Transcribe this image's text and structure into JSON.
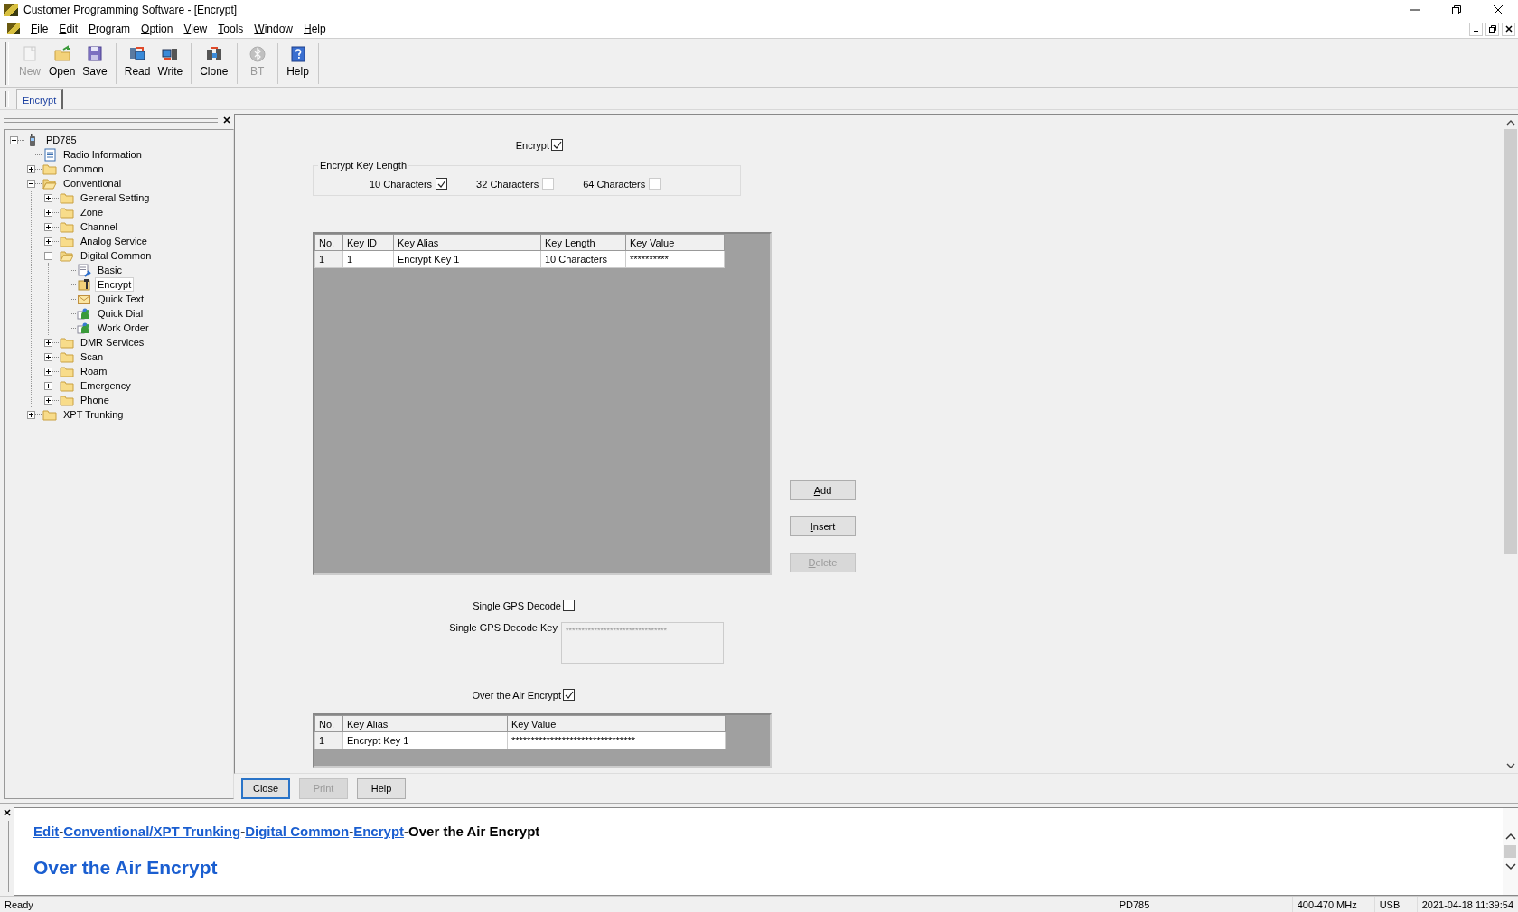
{
  "window": {
    "title": "Customer Programming Software - [Encrypt]"
  },
  "menu": [
    "File",
    "Edit",
    "Program",
    "Option",
    "View",
    "Tools",
    "Window",
    "Help"
  ],
  "toolbar": {
    "groups": [
      [
        {
          "label": "New",
          "kind": "new",
          "disabled": true
        },
        {
          "label": "Open",
          "kind": "open",
          "disabled": false
        },
        {
          "label": "Save",
          "kind": "save",
          "disabled": false
        }
      ],
      [
        {
          "label": "Read",
          "kind": "read",
          "disabled": false
        },
        {
          "label": "Write",
          "kind": "write",
          "disabled": false
        }
      ],
      [
        {
          "label": "Clone",
          "kind": "clone",
          "disabled": false
        }
      ],
      [
        {
          "label": "BT",
          "kind": "bluetooth",
          "disabled": true
        }
      ],
      [
        {
          "label": "Help",
          "kind": "help",
          "disabled": false
        }
      ]
    ]
  },
  "tabs": [
    {
      "label": "Encrypt",
      "selected": true
    }
  ],
  "tree": [
    {
      "label": "PD785",
      "kind": "radio",
      "expanded": true,
      "selected": false,
      "children": [
        {
          "label": "Radio Information",
          "kind": "info",
          "selected": false
        },
        {
          "label": "Common",
          "kind": "folder",
          "expanded": false,
          "selected": false
        },
        {
          "label": "Conventional",
          "kind": "folder",
          "expanded": true,
          "selected": false,
          "children": [
            {
              "label": "General Setting",
              "kind": "folder",
              "expanded": false,
              "selected": false
            },
            {
              "label": "Zone",
              "kind": "folder",
              "expanded": false,
              "selected": false
            },
            {
              "label": "Channel",
              "kind": "folder",
              "expanded": false,
              "selected": false
            },
            {
              "label": "Analog Service",
              "kind": "folder",
              "expanded": false,
              "selected": false
            },
            {
              "label": "Digital Common",
              "kind": "folder",
              "expanded": true,
              "selected": false,
              "children": [
                {
                  "label": "Basic",
                  "kind": "settings",
                  "selected": false
                },
                {
                  "label": "Encrypt",
                  "kind": "key",
                  "selected": true
                },
                {
                  "label": "Quick Text",
                  "kind": "mail",
                  "selected": false
                },
                {
                  "label": "Quick Dial",
                  "kind": "contacts",
                  "selected": false
                },
                {
                  "label": "Work Order",
                  "kind": "contacts",
                  "selected": false
                }
              ]
            },
            {
              "label": "DMR Services",
              "kind": "folder",
              "expanded": false,
              "selected": false
            },
            {
              "label": "Scan",
              "kind": "folder",
              "expanded": false,
              "selected": false
            },
            {
              "label": "Roam",
              "kind": "folder",
              "expanded": false,
              "selected": false
            },
            {
              "label": "Emergency",
              "kind": "folder",
              "expanded": false,
              "selected": false
            },
            {
              "label": "Phone",
              "kind": "folder",
              "expanded": false,
              "selected": false
            }
          ]
        },
        {
          "label": "XPT Trunking",
          "kind": "folder",
          "expanded": false,
          "selected": false
        }
      ]
    }
  ],
  "form": {
    "encrypt": {
      "label": "Encrypt",
      "checked": true
    },
    "key_length": {
      "title": "Encrypt Key Length",
      "options": [
        {
          "label": "10 Characters",
          "checked": true
        },
        {
          "label": "32 Characters",
          "checked": false
        },
        {
          "label": "64 Characters",
          "checked": false
        }
      ]
    },
    "key_table": {
      "columns": [
        "No.",
        "Key ID",
        "Key Alias",
        "Key Length",
        "Key Value"
      ],
      "rows": [
        [
          "1",
          "1",
          "Encrypt Key 1",
          "10 Characters",
          "**********"
        ]
      ]
    },
    "side_buttons": [
      {
        "label": "Add",
        "disabled": false
      },
      {
        "label": "Insert",
        "disabled": false
      },
      {
        "label": "Delete",
        "disabled": true
      }
    ],
    "single_gps_decode": {
      "label": "Single GPS Decode",
      "checked": false
    },
    "single_gps_decode_key": {
      "label": "Single GPS Decode Key",
      "value": "********************************",
      "disabled": true
    },
    "over_the_air_encrypt": {
      "label": "Over the Air Encrypt",
      "checked": true
    },
    "ota_table": {
      "columns": [
        "No.",
        "Key Alias",
        "Key Value"
      ],
      "rows": [
        [
          "1",
          "Encrypt Key 1",
          "********************************"
        ]
      ]
    }
  },
  "bottom_buttons": [
    {
      "label": "Close",
      "disabled": false,
      "default": true
    },
    {
      "label": "Print",
      "disabled": true,
      "default": false
    },
    {
      "label": "Help",
      "disabled": false,
      "default": false
    }
  ],
  "help_pane": {
    "breadcrumb": [
      {
        "text": "Edit",
        "kind": "link"
      },
      {
        "text": "-",
        "kind": "text"
      },
      {
        "text": "Conventional/XPT Trunking",
        "kind": "link"
      },
      {
        "text": "-",
        "kind": "text"
      },
      {
        "text": "Digital Common",
        "kind": "link"
      },
      {
        "text": "-",
        "kind": "text"
      },
      {
        "text": "Encrypt",
        "kind": "link"
      },
      {
        "text": "-Over the Air Encrypt",
        "kind": "text"
      }
    ],
    "heading": "Over the Air Encrypt"
  },
  "status_bar": [
    "Ready",
    "PD785",
    "400-470 MHz",
    "USB",
    "2021-04-18 11:39:54"
  ]
}
